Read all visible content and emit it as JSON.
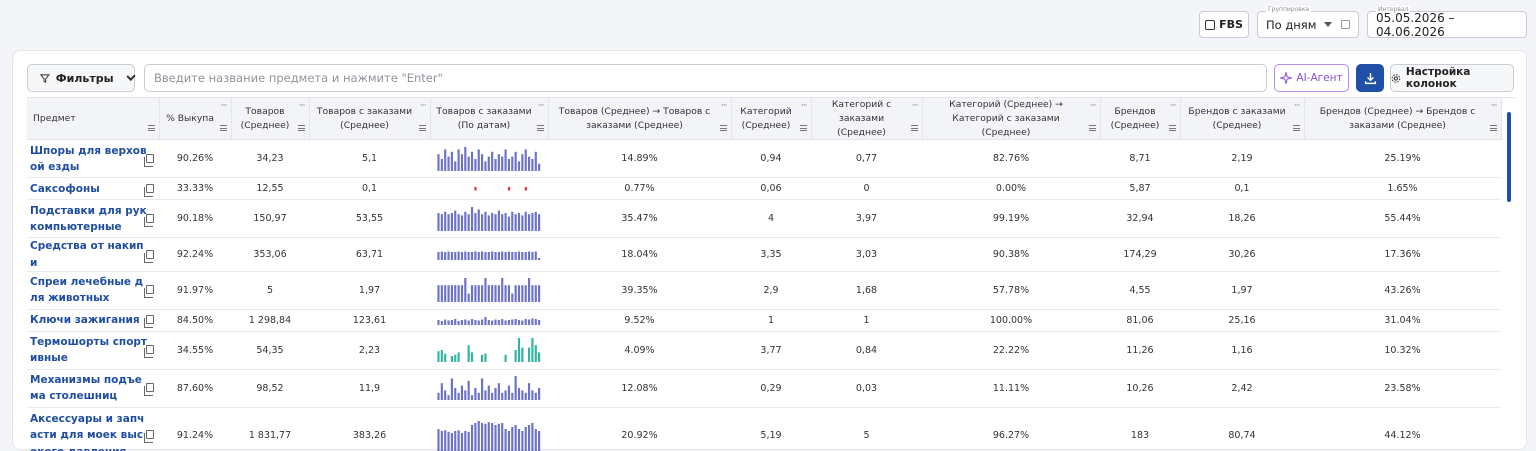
{
  "topbar": {
    "fbs_label": "FBS",
    "grouping": {
      "caption": "Группировка",
      "value": "По дням"
    },
    "interval": {
      "caption": "Интервал",
      "value": "05.05.2026 – 04.06.2026"
    }
  },
  "toolbar": {
    "filters_label": "Фильтры",
    "search_placeholder": "Введите название предмета и нажмите \"Enter\"",
    "ai_label": "AI-Агент",
    "columns_label": "Настройка колонок"
  },
  "colors": {
    "bar": "#6c72c4",
    "bar_green": "#2fb5a0",
    "dot_red": "#e0333a",
    "link": "#1f4d9f",
    "accent": "#1f4fa6"
  },
  "table": {
    "headers": [
      "Предмет",
      "% Выкупа",
      "Товаров (Среднее)",
      "Товаров с заказами (Среднее)",
      "Товаров с заказами (По датам)",
      "Товаров (Среднее) → Товаров с заказами (Среднее)",
      "Категорий (Среднее)",
      "Категорий с заказами (Среднее)",
      "Категорий (Среднее) → Категорий с заказами (Среднее)",
      "Брендов (Среднее)",
      "Брендов с заказами (Среднее)",
      "Брендов (Среднее) → Брендов с заказами (Среднее)"
    ],
    "rows": [
      {
        "name": "Шпоры для верховой езды",
        "pct": "90.26%",
        "goods": "34,23",
        "goods_ord": "5,1",
        "conv1": "14.89%",
        "cat": "0,94",
        "cat_ord": "0,77",
        "conv2": "82.76%",
        "brand": "8,71",
        "brand_ord": "2,19",
        "conv3": "25.19%",
        "spark_style": "bar",
        "spark": [
          0.7,
          0.5,
          0.9,
          0.6,
          0.8,
          0.4,
          0.9,
          0.7,
          1,
          0.6,
          0.8,
          0.5,
          0.9,
          0.7,
          0.4,
          0.6,
          0.8,
          0.5,
          0.7,
          0.6,
          0.9,
          0.5,
          0.6,
          0.8,
          0.4,
          0.7,
          0.9,
          0.6,
          0.5,
          0.8,
          0.3
        ]
      },
      {
        "name": "Саксофоны",
        "pct": "33.33%",
        "goods": "12,55",
        "goods_ord": "0,1",
        "conv1": "0.77%",
        "cat": "0,06",
        "cat_ord": "0",
        "conv2": "0.00%",
        "brand": "5,87",
        "brand_ord": "0,1",
        "conv3": "1.65%",
        "spark_style": "dots",
        "spark": [
          0,
          0,
          0,
          0,
          0,
          0,
          0,
          0,
          0,
          0,
          0,
          1,
          0,
          0,
          0,
          0,
          0,
          0,
          0,
          0,
          0,
          1,
          0,
          0,
          0,
          0,
          1,
          0,
          0,
          0,
          0
        ]
      },
      {
        "name": "Подставки для рук компьютерные",
        "pct": "90.18%",
        "goods": "150,97",
        "goods_ord": "53,55",
        "conv1": "35.47%",
        "cat": "4",
        "cat_ord": "3,97",
        "conv2": "99.19%",
        "brand": "32,94",
        "brand_ord": "18,26",
        "conv3": "55.44%",
        "spark_style": "bar",
        "spark": [
          0.75,
          0.7,
          0.8,
          0.7,
          0.75,
          0.85,
          0.7,
          0.65,
          0.8,
          0.7,
          1,
          0.75,
          0.9,
          0.7,
          0.8,
          0.65,
          0.75,
          0.7,
          0.85,
          0.7,
          0.75,
          0.6,
          0.8,
          0.7,
          0.75,
          0.65,
          0.8,
          0.7,
          0.75,
          0.8,
          0.7
        ]
      },
      {
        "name": "Средства от накипи",
        "pct": "92.24%",
        "goods": "353,06",
        "goods_ord": "63,71",
        "conv1": "18.04%",
        "cat": "3,35",
        "cat_ord": "3,03",
        "conv2": "90.38%",
        "brand": "174,29",
        "brand_ord": "30,26",
        "conv3": "17.36%",
        "spark_style": "bar",
        "spark": [
          0.8,
          0.85,
          0.8,
          0.85,
          0.8,
          0.8,
          0.85,
          0.8,
          0.85,
          0.8,
          0.8,
          0.85,
          0.8,
          0.85,
          0.8,
          0.8,
          0.85,
          0.8,
          0.8,
          0.85,
          0.8,
          0.85,
          0.8,
          0.8,
          0.85,
          0.8,
          0.8,
          0.85,
          0.8,
          0.85,
          0.2
        ]
      },
      {
        "name": "Спреи лечебные для животных",
        "pct": "91.97%",
        "goods": "5",
        "goods_ord": "1,97",
        "conv1": "39.35%",
        "cat": "2,9",
        "cat_ord": "1,68",
        "conv2": "57.78%",
        "brand": "4,55",
        "brand_ord": "1,97",
        "conv3": "43.26%",
        "spark_style": "bar",
        "spark": [
          0.7,
          0.7,
          0.7,
          0.7,
          0.7,
          0.7,
          0.7,
          0.7,
          1,
          0.35,
          0.7,
          0.7,
          0.7,
          0.7,
          1,
          0.7,
          0.7,
          0.7,
          0.7,
          1,
          0.7,
          0.7,
          0.35,
          0.7,
          0.7,
          0.7,
          0.7,
          1,
          0.7,
          0.7,
          0.7
        ]
      },
      {
        "name": "Ключи зажигания",
        "pct": "84.50%",
        "goods": "1 298,84",
        "goods_ord": "123,61",
        "conv1": "9.52%",
        "cat": "1",
        "cat_ord": "1",
        "conv2": "100.00%",
        "brand": "81,06",
        "brand_ord": "25,16",
        "conv3": "31.04%",
        "spark_style": "bar",
        "spark": [
          0.5,
          0.4,
          0.55,
          0.45,
          0.5,
          0.6,
          0.4,
          0.5,
          0.55,
          0.45,
          0.6,
          0.5,
          0.45,
          0.55,
          0.8,
          0.5,
          0.45,
          0.55,
          0.5,
          0.6,
          0.45,
          0.5,
          0.55,
          0.6,
          0.5,
          0.45,
          0.6,
          0.55,
          0.65,
          0.6,
          0.5
        ]
      },
      {
        "name": "Термошорты спортивные",
        "pct": "34.55%",
        "goods": "54,35",
        "goods_ord": "2,23",
        "conv1": "4.09%",
        "cat": "3,77",
        "cat_ord": "0,84",
        "conv2": "22.22%",
        "brand": "11,26",
        "brand_ord": "1,16",
        "conv3": "10.32%",
        "spark_style": "green",
        "spark": [
          0.45,
          0.5,
          0.35,
          0,
          0.25,
          0.3,
          0.4,
          0,
          0,
          0.7,
          0.4,
          0,
          0,
          0.3,
          0.35,
          0,
          0,
          0,
          0,
          0,
          0.3,
          0,
          0,
          0.5,
          1,
          0.6,
          0,
          0.6,
          1,
          0.7,
          0.4
        ]
      },
      {
        "name": "Механизмы подъема столешниц",
        "pct": "87.60%",
        "goods": "98,52",
        "goods_ord": "11,9",
        "conv1": "12.08%",
        "cat": "0,29",
        "cat_ord": "0,03",
        "conv2": "11.11%",
        "brand": "10,26",
        "brand_ord": "2,42",
        "conv3": "23.58%",
        "spark_style": "bar",
        "spark": [
          0.3,
          0.7,
          0.4,
          0.2,
          0.9,
          0.5,
          0.3,
          0.6,
          0.4,
          0.8,
          0.2,
          0.5,
          0.3,
          0.9,
          0.4,
          0.6,
          0.3,
          0.5,
          0.7,
          0.3,
          0.4,
          0.6,
          0.3,
          1,
          0.5,
          0.4,
          0.3,
          0.7,
          0.4,
          0.3,
          0.5
        ]
      },
      {
        "name": "Аксессуары и запчасти для моек высокого давления",
        "pct": "91.24%",
        "goods": "1 831,77",
        "goods_ord": "383,26",
        "conv1": "20.92%",
        "cat": "5,19",
        "cat_ord": "5",
        "conv2": "96.27%",
        "brand": "183",
        "brand_ord": "80,74",
        "conv3": "44.12%",
        "spark_style": "bar",
        "spark": [
          0.65,
          0.6,
          0.62,
          0.58,
          0.55,
          0.6,
          0.62,
          0.55,
          0.6,
          0.58,
          0.75,
          0.8,
          0.85,
          0.8,
          0.78,
          0.82,
          0.8,
          0.75,
          0.78,
          0.8,
          0.65,
          0.6,
          0.7,
          0.75,
          0.65,
          0.6,
          0.7,
          0.75,
          0.8,
          0.65,
          0.6
        ]
      }
    ]
  }
}
